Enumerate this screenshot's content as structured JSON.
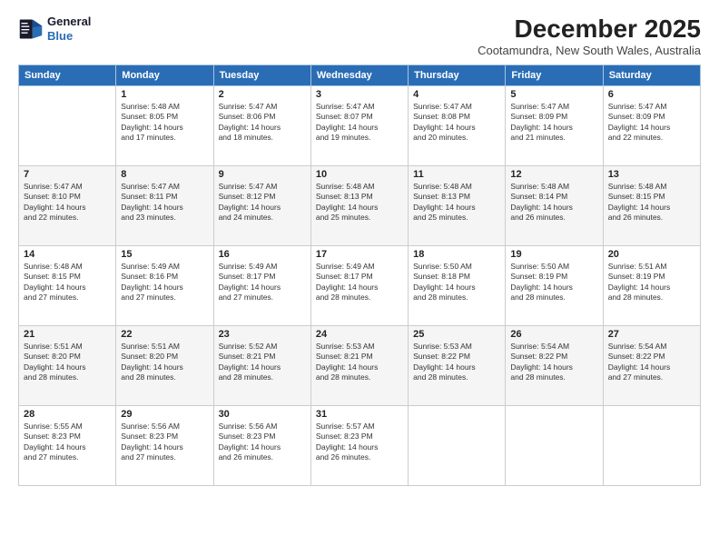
{
  "header": {
    "logo_line1": "General",
    "logo_line2": "Blue",
    "month": "December 2025",
    "location": "Cootamundra, New South Wales, Australia"
  },
  "days_of_week": [
    "Sunday",
    "Monday",
    "Tuesday",
    "Wednesday",
    "Thursday",
    "Friday",
    "Saturday"
  ],
  "weeks": [
    [
      {
        "day": "",
        "info": ""
      },
      {
        "day": "1",
        "info": "Sunrise: 5:48 AM\nSunset: 8:05 PM\nDaylight: 14 hours\nand 17 minutes."
      },
      {
        "day": "2",
        "info": "Sunrise: 5:47 AM\nSunset: 8:06 PM\nDaylight: 14 hours\nand 18 minutes."
      },
      {
        "day": "3",
        "info": "Sunrise: 5:47 AM\nSunset: 8:07 PM\nDaylight: 14 hours\nand 19 minutes."
      },
      {
        "day": "4",
        "info": "Sunrise: 5:47 AM\nSunset: 8:08 PM\nDaylight: 14 hours\nand 20 minutes."
      },
      {
        "day": "5",
        "info": "Sunrise: 5:47 AM\nSunset: 8:09 PM\nDaylight: 14 hours\nand 21 minutes."
      },
      {
        "day": "6",
        "info": "Sunrise: 5:47 AM\nSunset: 8:09 PM\nDaylight: 14 hours\nand 22 minutes."
      }
    ],
    [
      {
        "day": "7",
        "info": "Sunrise: 5:47 AM\nSunset: 8:10 PM\nDaylight: 14 hours\nand 22 minutes."
      },
      {
        "day": "8",
        "info": "Sunrise: 5:47 AM\nSunset: 8:11 PM\nDaylight: 14 hours\nand 23 minutes."
      },
      {
        "day": "9",
        "info": "Sunrise: 5:47 AM\nSunset: 8:12 PM\nDaylight: 14 hours\nand 24 minutes."
      },
      {
        "day": "10",
        "info": "Sunrise: 5:48 AM\nSunset: 8:13 PM\nDaylight: 14 hours\nand 25 minutes."
      },
      {
        "day": "11",
        "info": "Sunrise: 5:48 AM\nSunset: 8:13 PM\nDaylight: 14 hours\nand 25 minutes."
      },
      {
        "day": "12",
        "info": "Sunrise: 5:48 AM\nSunset: 8:14 PM\nDaylight: 14 hours\nand 26 minutes."
      },
      {
        "day": "13",
        "info": "Sunrise: 5:48 AM\nSunset: 8:15 PM\nDaylight: 14 hours\nand 26 minutes."
      }
    ],
    [
      {
        "day": "14",
        "info": "Sunrise: 5:48 AM\nSunset: 8:15 PM\nDaylight: 14 hours\nand 27 minutes."
      },
      {
        "day": "15",
        "info": "Sunrise: 5:49 AM\nSunset: 8:16 PM\nDaylight: 14 hours\nand 27 minutes."
      },
      {
        "day": "16",
        "info": "Sunrise: 5:49 AM\nSunset: 8:17 PM\nDaylight: 14 hours\nand 27 minutes."
      },
      {
        "day": "17",
        "info": "Sunrise: 5:49 AM\nSunset: 8:17 PM\nDaylight: 14 hours\nand 28 minutes."
      },
      {
        "day": "18",
        "info": "Sunrise: 5:50 AM\nSunset: 8:18 PM\nDaylight: 14 hours\nand 28 minutes."
      },
      {
        "day": "19",
        "info": "Sunrise: 5:50 AM\nSunset: 8:19 PM\nDaylight: 14 hours\nand 28 minutes."
      },
      {
        "day": "20",
        "info": "Sunrise: 5:51 AM\nSunset: 8:19 PM\nDaylight: 14 hours\nand 28 minutes."
      }
    ],
    [
      {
        "day": "21",
        "info": "Sunrise: 5:51 AM\nSunset: 8:20 PM\nDaylight: 14 hours\nand 28 minutes."
      },
      {
        "day": "22",
        "info": "Sunrise: 5:51 AM\nSunset: 8:20 PM\nDaylight: 14 hours\nand 28 minutes."
      },
      {
        "day": "23",
        "info": "Sunrise: 5:52 AM\nSunset: 8:21 PM\nDaylight: 14 hours\nand 28 minutes."
      },
      {
        "day": "24",
        "info": "Sunrise: 5:53 AM\nSunset: 8:21 PM\nDaylight: 14 hours\nand 28 minutes."
      },
      {
        "day": "25",
        "info": "Sunrise: 5:53 AM\nSunset: 8:22 PM\nDaylight: 14 hours\nand 28 minutes."
      },
      {
        "day": "26",
        "info": "Sunrise: 5:54 AM\nSunset: 8:22 PM\nDaylight: 14 hours\nand 28 minutes."
      },
      {
        "day": "27",
        "info": "Sunrise: 5:54 AM\nSunset: 8:22 PM\nDaylight: 14 hours\nand 27 minutes."
      }
    ],
    [
      {
        "day": "28",
        "info": "Sunrise: 5:55 AM\nSunset: 8:23 PM\nDaylight: 14 hours\nand 27 minutes."
      },
      {
        "day": "29",
        "info": "Sunrise: 5:56 AM\nSunset: 8:23 PM\nDaylight: 14 hours\nand 27 minutes."
      },
      {
        "day": "30",
        "info": "Sunrise: 5:56 AM\nSunset: 8:23 PM\nDaylight: 14 hours\nand 26 minutes."
      },
      {
        "day": "31",
        "info": "Sunrise: 5:57 AM\nSunset: 8:23 PM\nDaylight: 14 hours\nand 26 minutes."
      },
      {
        "day": "",
        "info": ""
      },
      {
        "day": "",
        "info": ""
      },
      {
        "day": "",
        "info": ""
      }
    ]
  ]
}
